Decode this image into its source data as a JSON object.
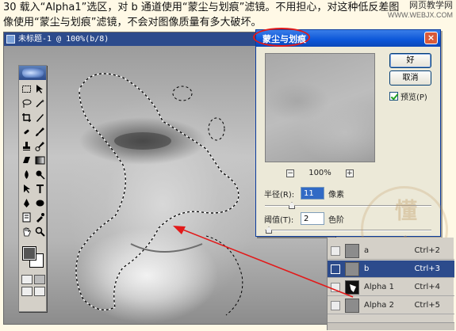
{
  "caption": {
    "line1": "30 载入“Alpha1”选区，对 b 通道使用“蒙尘与划痕”滤镜。不用担心，对这种低反差图",
    "line2": "像使用“蒙尘与划痕”滤镜，不会对图像质量有多大破坏。"
  },
  "site_mark": {
    "title": "网页教学网",
    "url": "WWW.WEBJX.COM"
  },
  "document": {
    "title": "未标题-1 @ 100%(b/8)"
  },
  "dialog": {
    "title": "蒙尘与划痕",
    "ok_label": "好",
    "cancel_label": "取消",
    "preview_label": "预览(P)",
    "zoom_level": "100%",
    "zoom_out": "−",
    "zoom_in": "+",
    "radius_label": "半径(R):",
    "radius_value": "11",
    "radius_unit": "像素",
    "threshold_label": "阈值(T):",
    "threshold_value": "2",
    "threshold_unit": "色阶"
  },
  "channels": [
    {
      "name": "a",
      "shortcut": "Ctrl+2",
      "selected": false,
      "thumb": "gray"
    },
    {
      "name": "b",
      "shortcut": "Ctrl+3",
      "selected": true,
      "thumb": "gray"
    },
    {
      "name": "Alpha 1",
      "shortcut": "Ctrl+4",
      "selected": false,
      "thumb": "alpha"
    },
    {
      "name": "Alpha 2",
      "shortcut": "Ctrl+5",
      "selected": false,
      "thumb": "gray"
    }
  ],
  "watermark": {
    "text": "懂 斋"
  },
  "colors": {
    "annotation": "#e21a1a",
    "titlebar": "#0b55d8",
    "selected_channel": "#2c4b8c"
  }
}
